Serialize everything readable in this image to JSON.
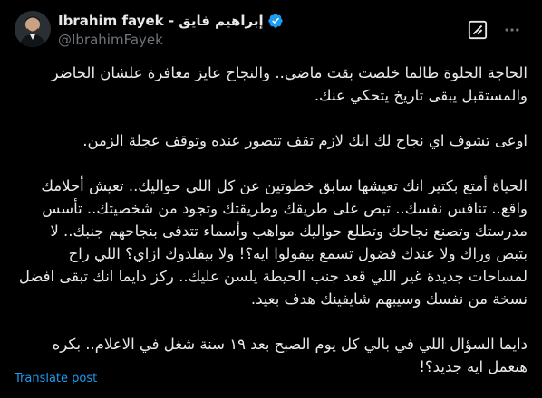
{
  "author": {
    "display_name": "Ibrahim fayek - إبراهيم فايق",
    "handle": "@IbrahimFayek",
    "verified": true,
    "avatar_icon": "avatar-photo"
  },
  "header_actions": {
    "grok_icon": "grok-icon",
    "more_icon": "more-dots-icon"
  },
  "post": {
    "paragraphs": [
      "الحاجة الحلوة طالما خلصت بقت ماضي.. والنجاح عايز معافرة علشان الحاضر والمستقبل يبقى تاريخ يتحكي عنك.",
      "اوعى تشوف اي نجاح لك انك لازم تقف تتصور عنده وتوقف عجلة الزمن.",
      "الحياة أمتع بكتير انك تعيشها سابق خطوتين عن كل اللي حواليك.. تعيش أحلامك واقع.. تنافس نفسك.. تبص على طريقك وطريقتك وتجود من شخصيتك.. تأسس مدرستك وتصنع نجاحك وتطلع حواليك مواهب وأسماء تتدفى بنجاحهم جنبك.. لا بتبص وراك ولا عندك فضول تسمع بيقولوا ايه؟! ولا بيقلدوك ازاي؟ اللي راح لمساحات جديدة غير اللي قعد جنب الحيطة يلسن عليك.. ركز دايما انك تبقى افضل نسخة من نفسك وسيبهم شايفينك هدف بعيد.",
      "دايما السؤال اللي في بالي كل يوم الصبح بعد ١٩ سنة شغل في الاعلام.. بكره هنعمل ايه جديد؟!"
    ]
  },
  "footer": {
    "translate_label": "Translate post"
  },
  "colors": {
    "background": "#000000",
    "text": "#e7e9ea",
    "secondary": "#71767b",
    "accent": "#1d9bf0"
  }
}
